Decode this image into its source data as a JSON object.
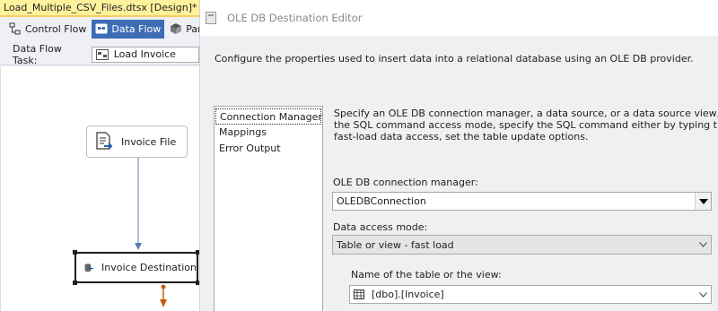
{
  "designer": {
    "doc_tab": {
      "title": "Load_Multiple_CSV_Files.dtsx [Design]*",
      "pin": "⊕",
      "close": "×"
    },
    "tabs": [
      {
        "label": "Control Flow",
        "icon": "control-flow-icon",
        "active": false
      },
      {
        "label": "Data Flow",
        "icon": "data-flow-icon",
        "active": true
      },
      {
        "label": "Paramete",
        "icon": "parameters-icon",
        "active": false
      }
    ],
    "data_flow_task": {
      "label": "Data Flow Task:",
      "value": "Load Invoice"
    },
    "components": [
      {
        "name": "Invoice File",
        "icon": "flat-file-source-icon"
      },
      {
        "name": "Invoice Destination",
        "icon": "oledb-destination-icon"
      }
    ],
    "colors": {
      "active_tab": "#3e6db5",
      "doc_tab": "#fff29d",
      "path_arrow": "#5b7db3",
      "error_arrow": "#c55a11"
    }
  },
  "editor": {
    "title": "OLE DB Destination Editor",
    "intro": "Configure the properties used to insert data into a relational database using an OLE DB provider.",
    "nav": [
      "Connection Manager",
      "Mappings",
      "Error Output"
    ],
    "description": [
      "Specify an OLE DB connection manager, a data source, or a data source view, and select the da",
      "the SQL command access mode, specify the SQL command either by typing the query or by us",
      "fast-load data access, set the table update options."
    ],
    "connection_manager": {
      "label": "OLE DB connection manager:",
      "value": "OLEDBConnection"
    },
    "data_access_mode": {
      "label": "Data access mode:",
      "value": "Table or view - fast load"
    },
    "table_name": {
      "label": "Name of the table or the view:",
      "value": "[dbo].[Invoice]"
    }
  }
}
